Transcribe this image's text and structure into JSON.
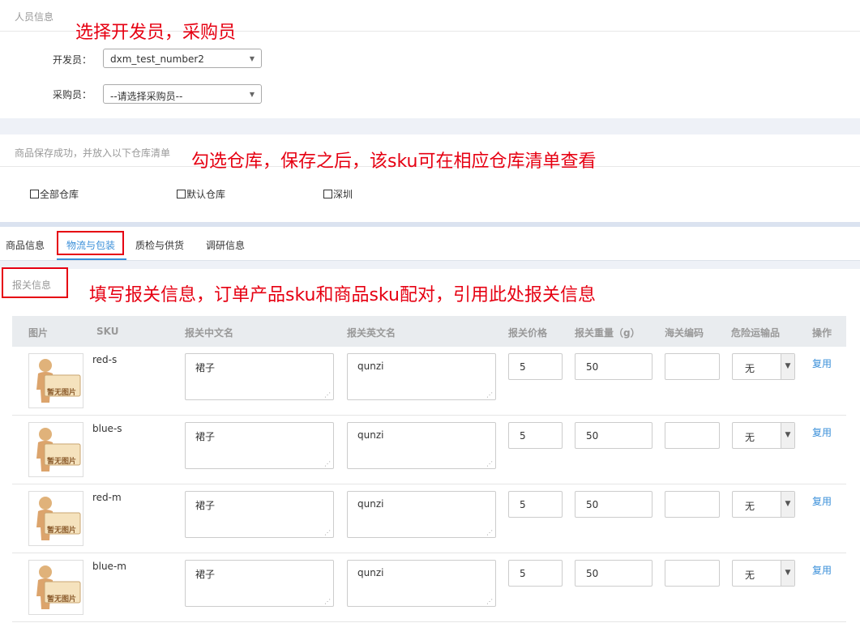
{
  "personnel": {
    "title": "人员信息",
    "annotation": "选择开发员，采购员",
    "developer_label": "开发员：",
    "developer_value": "dxm_test_number2",
    "buyer_label": "采购员：",
    "buyer_value": "--请选择采购员--"
  },
  "warehouse": {
    "title": "商品保存成功，并放入以下仓库清单",
    "annotation": "勾选仓库，保存之后，该sku可在相应仓库清单查看",
    "options": [
      "全部仓库",
      "默认仓库",
      "深圳"
    ]
  },
  "tabs": [
    "商品信息",
    "物流与包装",
    "质检与供货",
    "调研信息"
  ],
  "active_tab": "物流与包装",
  "customs": {
    "title": "报关信息",
    "annotation": "填写报关信息，订单产品sku和商品sku配对，引用此处报关信息",
    "columns": [
      "图片",
      "SKU",
      "报关中文名",
      "报关英文名",
      "报关价格",
      "报关重量（g）",
      "海关编码",
      "危险运输品",
      "操作"
    ],
    "placeholder_image_text": "暂无图片",
    "rows": [
      {
        "sku": "red-s",
        "cn_name": "裙子",
        "en_name": "qunzi",
        "price": "5",
        "weight": "50",
        "hs_code": "",
        "dangerous": "无",
        "action": "复用"
      },
      {
        "sku": "blue-s",
        "cn_name": "裙子",
        "en_name": "qunzi",
        "price": "5",
        "weight": "50",
        "hs_code": "",
        "dangerous": "无",
        "action": "复用"
      },
      {
        "sku": "red-m",
        "cn_name": "裙子",
        "en_name": "qunzi",
        "price": "5",
        "weight": "50",
        "hs_code": "",
        "dangerous": "无",
        "action": "复用"
      },
      {
        "sku": "blue-m",
        "cn_name": "裙子",
        "en_name": "qunzi",
        "price": "5",
        "weight": "50",
        "hs_code": "",
        "dangerous": "无",
        "action": "复用"
      }
    ]
  },
  "colors": {
    "annotation_red": "#e60012",
    "link_blue": "#3a8fd9",
    "band": "#eef1f7"
  }
}
